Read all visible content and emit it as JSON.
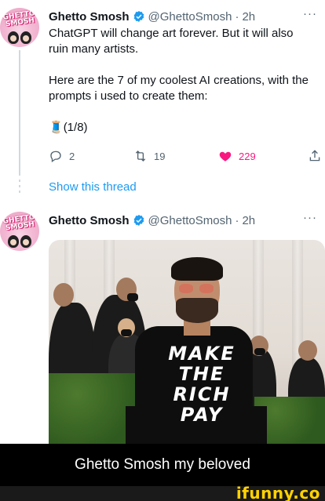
{
  "tweet1": {
    "avatar_text": "GHETTO SMOSH",
    "name": "Ghetto Smosh",
    "handle": "@GhettoSmosh",
    "separator": "·",
    "time": "2h",
    "more": "···",
    "line1": "ChatGPT will change art forever. But it will also",
    "line2": "ruin many artists.",
    "line3": "Here are the 7 of my coolest AI creations, with the",
    "line4": "prompts i used to create them:",
    "thread_marker": "(1/8)",
    "thread_emoji": "🧵",
    "replies": "2",
    "retweets": "19",
    "likes": "229"
  },
  "show_thread": "Show this thread",
  "tweet2": {
    "avatar_text": "GHETTO SMOSH",
    "name": "Ghetto Smosh",
    "handle": "@GhettoSmosh",
    "separator": "·",
    "time": "2h",
    "more": "···",
    "image_shirt_text": "MAKE THE RICH PAY"
  },
  "caption": "Ghetto Smosh my beloved",
  "watermark": "ifunny.co",
  "colors": {
    "link": "#1d9bf0",
    "like": "#f91880",
    "muted": "#536471",
    "watermark": "#ffd200"
  },
  "icons": [
    "reply-icon",
    "retweet-icon",
    "heart-icon",
    "share-icon",
    "verified-icon"
  ]
}
